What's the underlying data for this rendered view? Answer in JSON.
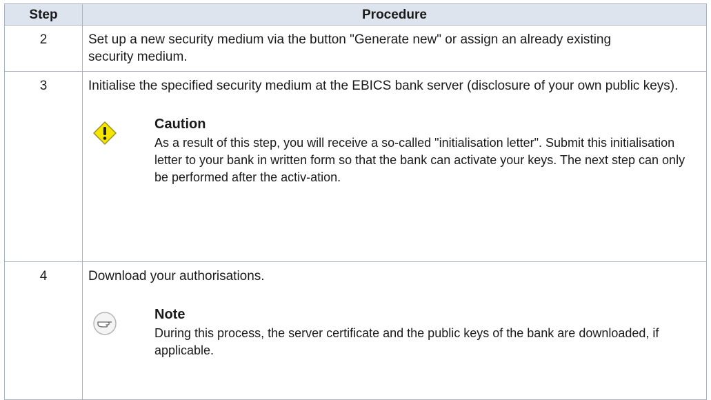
{
  "table": {
    "headers": {
      "step": "Step",
      "procedure": "Procedure"
    },
    "rows": [
      {
        "step": "2",
        "text": "Set up a new security medium via the button \"Generate new\" or assign an already existing security medium."
      },
      {
        "step": "3",
        "text": "Initialise the specified security medium at the EBICS bank server (disclosure of your own public keys).",
        "admonition": {
          "icon": "caution-icon",
          "title": "Caution",
          "text": "As a result of this step, you will receive a so-called \"initialisation letter\". Submit this initialisation letter to your bank in written form so that the bank can activate your keys. The next step can only be performed after the activ-ation."
        }
      },
      {
        "step": "4",
        "text": "Download your authorisations.",
        "admonition": {
          "icon": "note-icon",
          "title": "Note",
          "text": "During this process, the server certificate and the public keys of the bank are downloaded, if applicable."
        }
      }
    ]
  },
  "colors": {
    "header_bg": "#dde4ee",
    "border": "#a9b3c2",
    "caution_yellow": "#f5e600"
  }
}
